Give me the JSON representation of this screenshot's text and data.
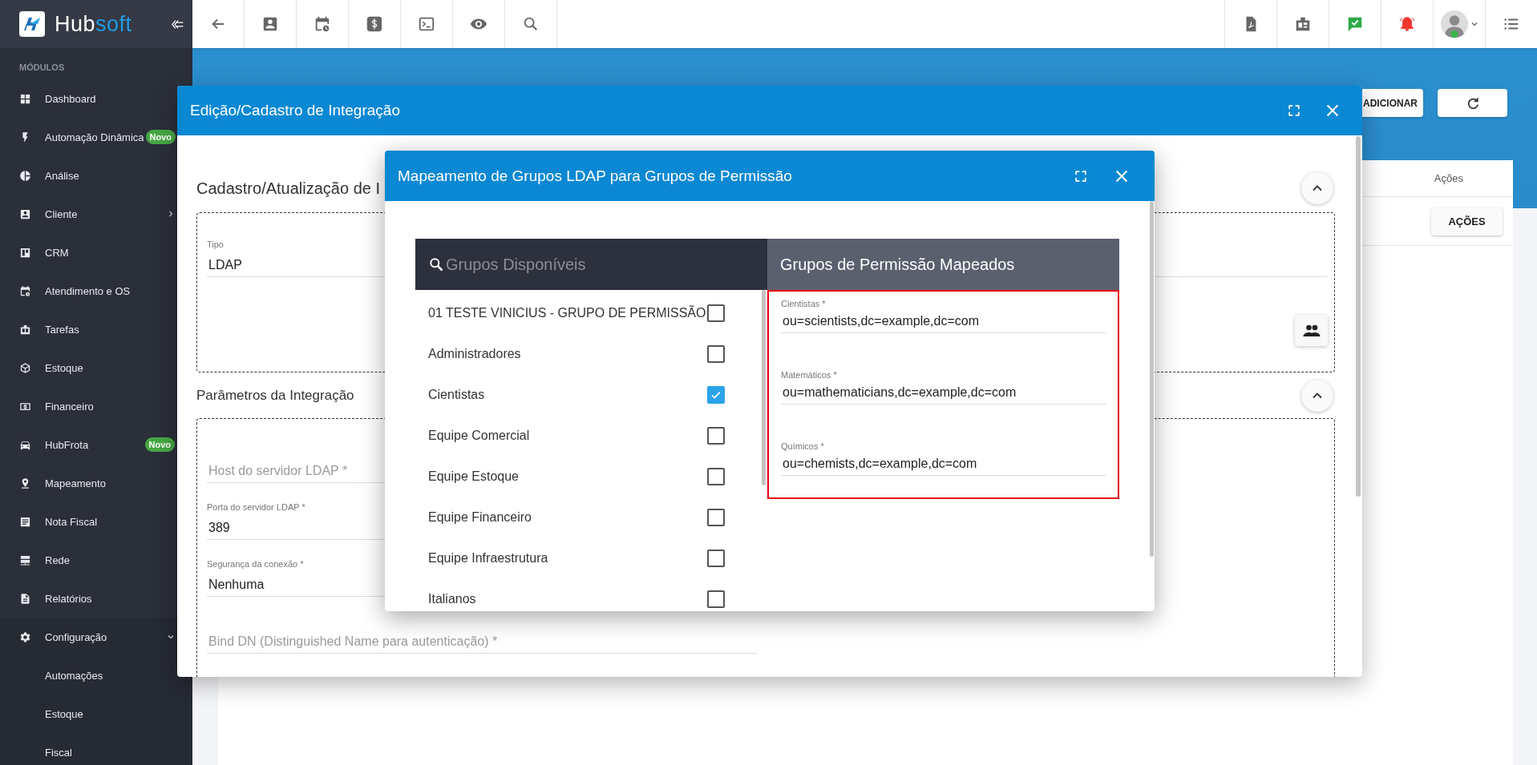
{
  "sidebar": {
    "brand": {
      "name": "Hub",
      "accent": "soft"
    },
    "section": "MÓDULOS",
    "items": [
      {
        "label": "Dashboard"
      },
      {
        "label": "Automação Dinâmica",
        "badge": "Novo"
      },
      {
        "label": "Análise"
      },
      {
        "label": "Cliente",
        "expanded": false
      },
      {
        "label": "CRM"
      },
      {
        "label": "Atendimento e OS"
      },
      {
        "label": "Tarefas"
      },
      {
        "label": "Estoque"
      },
      {
        "label": "Financeiro"
      },
      {
        "label": "HubFrota",
        "badge": "Novo"
      },
      {
        "label": "Mapeamento"
      },
      {
        "label": "Nota Fiscal"
      },
      {
        "label": "Rede"
      },
      {
        "label": "Relatórios"
      },
      {
        "label": "Configuração",
        "expanded": true,
        "children": [
          {
            "label": "Automações"
          },
          {
            "label": "Estoque"
          },
          {
            "label": "Fiscal"
          }
        ]
      }
    ]
  },
  "page": {
    "add_button": "ADICIONAR",
    "table": {
      "columns": [
        "Ações"
      ],
      "rows": [
        {
          "action_button": "AÇÕES"
        }
      ]
    }
  },
  "integration_dialog": {
    "title": "Edição/Cadastro de Integração",
    "section_title": "Cadastro/Atualização de I",
    "type_field": {
      "label": "Tipo",
      "value": "LDAP"
    },
    "params_title": "Parâmetros da Integração",
    "fields": [
      {
        "placeholder": "Host do servidor LDAP *"
      },
      {
        "label": "Porta do servidor LDAP *",
        "value": "389"
      },
      {
        "label": "Segurança da conexão *",
        "value": "Nenhuma"
      },
      {
        "placeholder": "Bind DN (Distinguished Name para autenticação) *"
      }
    ]
  },
  "mapping_dialog": {
    "title": "Mapeamento de Grupos LDAP para Grupos de Permissão",
    "search": {
      "placeholder": "Grupos Disponíveis"
    },
    "mapped_title": "Grupos de Permissão Mapeados",
    "groups": [
      {
        "label": "01 TESTE VINICIUS - GRUPO DE PERMISSÃO",
        "checked": false
      },
      {
        "label": "Administradores",
        "checked": false
      },
      {
        "label": "Cientistas",
        "checked": true
      },
      {
        "label": "Equipe Comercial",
        "checked": false
      },
      {
        "label": "Equipe Estoque",
        "checked": false
      },
      {
        "label": "Equipe Financeiro",
        "checked": false
      },
      {
        "label": "Equipe Infraestrutura",
        "checked": false
      },
      {
        "label": "Italianos",
        "checked": false
      }
    ],
    "mapped": [
      {
        "label": "Cientistas *",
        "value": "ou=scientists,dc=example,dc=com"
      },
      {
        "label": "Matemáticos *",
        "value": "ou=mathematicians,dc=example,dc=com"
      },
      {
        "label": "Químicos *",
        "value": "ou=chemists,dc=example,dc=com"
      }
    ]
  }
}
